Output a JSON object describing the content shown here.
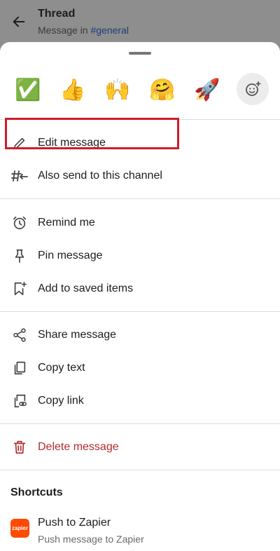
{
  "header": {
    "title": "Thread",
    "subtitle_prefix": "Message in",
    "channel": "#general"
  },
  "reactions": [
    {
      "icon": "white-check-mark-icon",
      "glyph": "✅"
    },
    {
      "icon": "thumbs-up-icon",
      "glyph": "👍"
    },
    {
      "icon": "raised-hands-icon",
      "glyph": "🙌"
    },
    {
      "icon": "hugging-face-icon",
      "glyph": "🤗"
    },
    {
      "icon": "rocket-icon",
      "glyph": "🚀"
    }
  ],
  "menu": {
    "edit": "Edit message",
    "also_send": "Also send to this channel",
    "remind": "Remind me",
    "pin": "Pin message",
    "save": "Add to saved items",
    "share": "Share message",
    "copy_text": "Copy text",
    "copy_link": "Copy link",
    "delete": "Delete message"
  },
  "shortcuts": {
    "title": "Shortcuts",
    "items": [
      {
        "logo": "zapier",
        "title": "Push to Zapier",
        "subtitle": "Push message to Zapier"
      }
    ]
  },
  "colors": {
    "danger": "#b42a2a",
    "highlight": "#d01c2a",
    "zapier": "#ff4a00"
  }
}
